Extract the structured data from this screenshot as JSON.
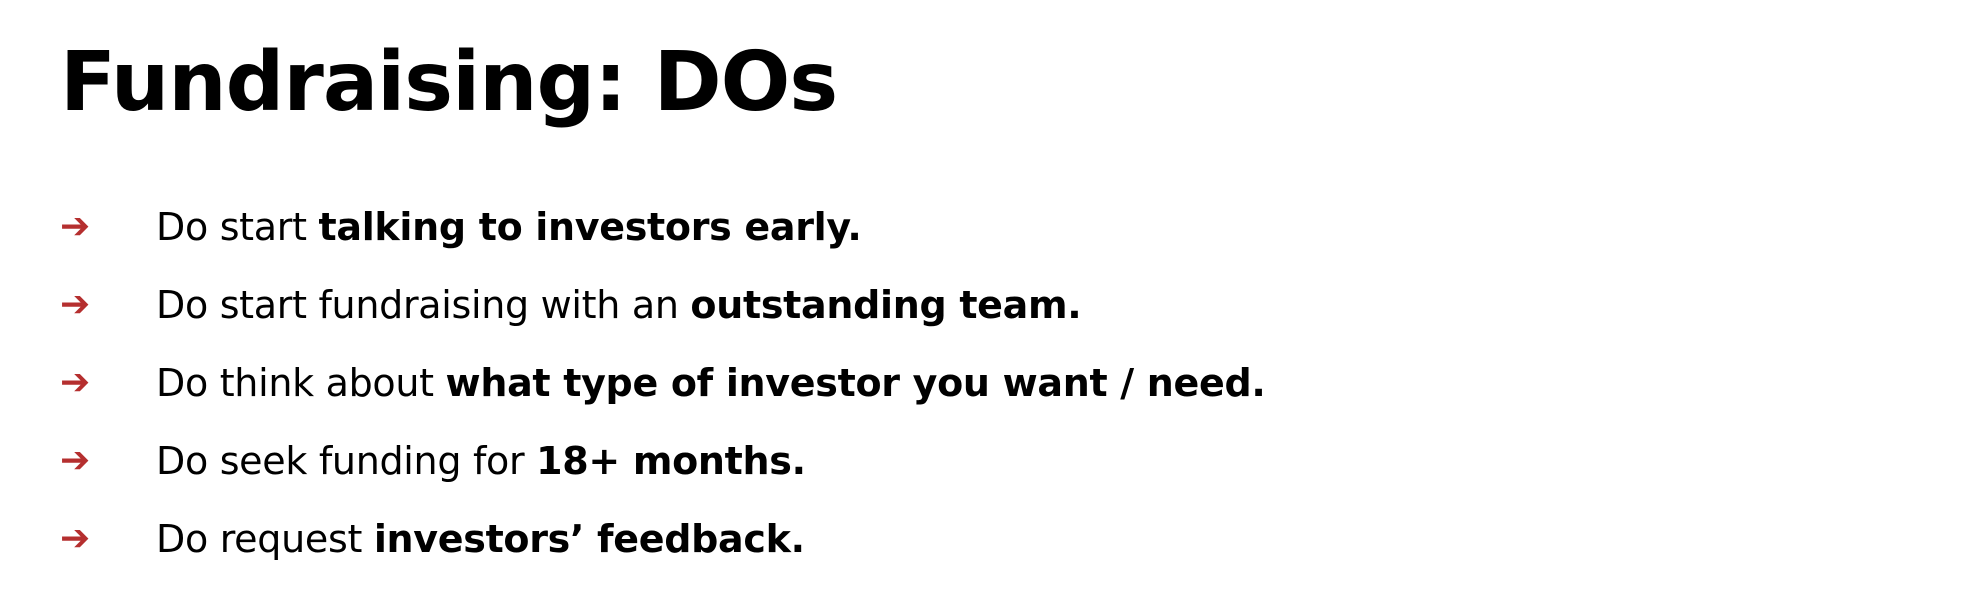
{
  "slide": {
    "title": "Fundraising: DOs",
    "bullet_glyph": "➔",
    "arrow_color": "#b52f2f",
    "bullets": [
      {
        "plain": "Do start ",
        "bold": "talking to investors early."
      },
      {
        "plain": "Do start fundraising with an ",
        "bold": "outstanding team."
      },
      {
        "plain": "Do think about ",
        "bold": "what type of investor you want / need."
      },
      {
        "plain": "Do seek funding for ",
        "bold": "18+ months."
      },
      {
        "plain": "Do request ",
        "bold": "investors’ feedback."
      }
    ]
  }
}
